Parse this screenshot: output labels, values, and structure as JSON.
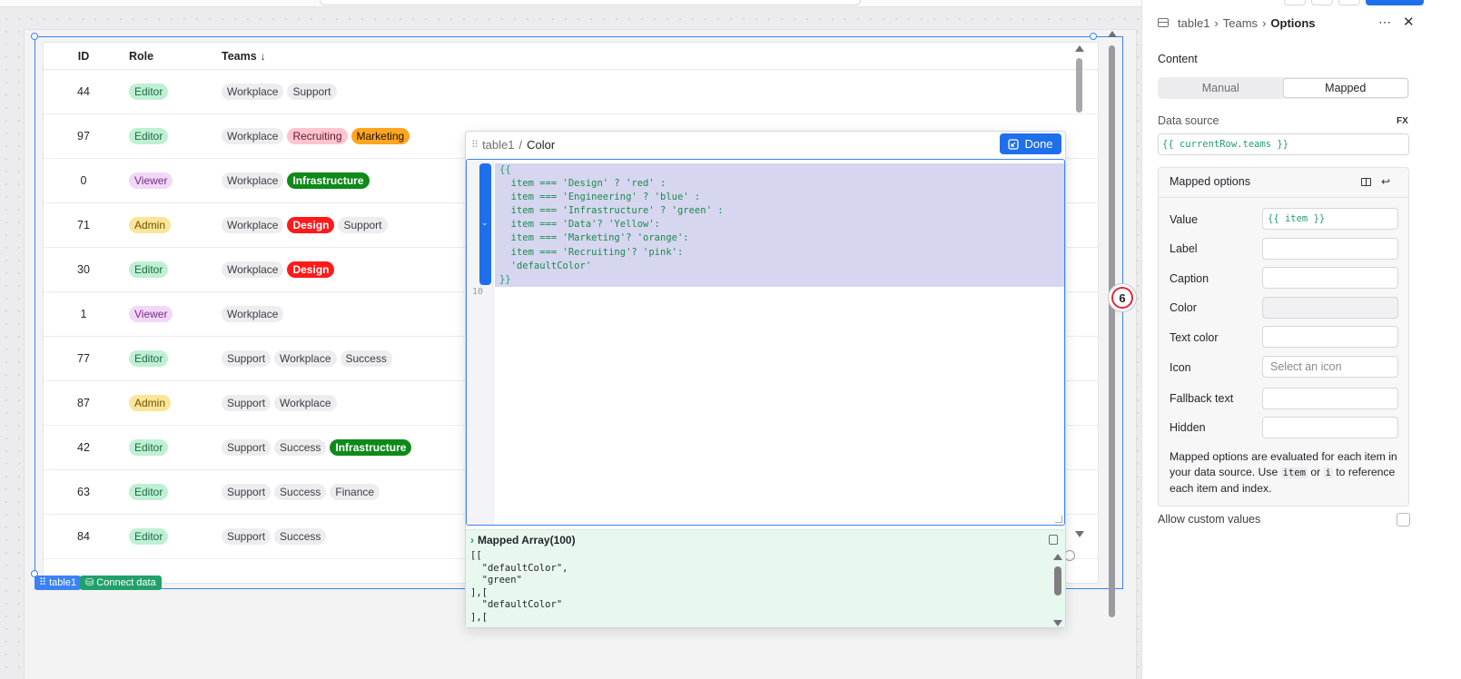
{
  "table": {
    "component_tag": "table1",
    "connect_label": "Connect data",
    "headers": {
      "id": "ID",
      "role": "Role",
      "teams": "Teams",
      "sort_icon": "↓"
    },
    "rows": [
      {
        "id": "44",
        "role": "Editor",
        "teams": [
          {
            "label": "Workplace",
            "color": "default"
          },
          {
            "label": "Support",
            "color": "default"
          }
        ]
      },
      {
        "id": "97",
        "role": "Editor",
        "teams": [
          {
            "label": "Workplace",
            "color": "default"
          },
          {
            "label": "Recruiting",
            "color": "pink"
          },
          {
            "label": "Marketing",
            "color": "orange"
          }
        ]
      },
      {
        "id": "0",
        "role": "Viewer",
        "teams": [
          {
            "label": "Workplace",
            "color": "default"
          },
          {
            "label": "Infrastructure",
            "color": "green"
          }
        ]
      },
      {
        "id": "71",
        "role": "Admin",
        "teams": [
          {
            "label": "Workplace",
            "color": "default"
          },
          {
            "label": "Design",
            "color": "red"
          },
          {
            "label": "Support",
            "color": "default"
          }
        ]
      },
      {
        "id": "30",
        "role": "Editor",
        "teams": [
          {
            "label": "Workplace",
            "color": "default"
          },
          {
            "label": "Design",
            "color": "red"
          }
        ]
      },
      {
        "id": "1",
        "role": "Viewer",
        "teams": [
          {
            "label": "Workplace",
            "color": "default"
          }
        ]
      },
      {
        "id": "77",
        "role": "Editor",
        "teams": [
          {
            "label": "Support",
            "color": "default"
          },
          {
            "label": "Workplace",
            "color": "default"
          },
          {
            "label": "Success",
            "color": "default"
          }
        ]
      },
      {
        "id": "87",
        "role": "Admin",
        "teams": [
          {
            "label": "Support",
            "color": "default"
          },
          {
            "label": "Workplace",
            "color": "default"
          }
        ]
      },
      {
        "id": "42",
        "role": "Editor",
        "teams": [
          {
            "label": "Support",
            "color": "default"
          },
          {
            "label": "Success",
            "color": "default"
          },
          {
            "label": "Infrastructure",
            "color": "green"
          }
        ]
      },
      {
        "id": "63",
        "role": "Editor",
        "teams": [
          {
            "label": "Support",
            "color": "default"
          },
          {
            "label": "Success",
            "color": "default"
          },
          {
            "label": "Finance",
            "color": "default"
          }
        ]
      },
      {
        "id": "84",
        "role": "Editor",
        "teams": [
          {
            "label": "Support",
            "color": "default"
          },
          {
            "label": "Success",
            "color": "default"
          }
        ]
      }
    ]
  },
  "canvas": {
    "badge_count": "6"
  },
  "code_popup": {
    "breadcrumb_parent": "table1",
    "breadcrumb_separator": "/",
    "breadcrumb_current": "Color",
    "done_label": "Done",
    "line_10": "10",
    "code_lines": [
      "{{",
      "  item === 'Design' ? 'red' :",
      "  item === 'Engineering' ? 'blue' :",
      "  item === 'Infrastructure' ? 'green' :",
      "  item === 'Data'? 'Yellow':",
      "  item === 'Marketing'? 'orange':",
      "  item === 'Recruiting'? 'pink':",
      "  'defaultColor'",
      "}}"
    ],
    "result_title": "Mapped Array(100)",
    "result_lines": [
      "[[",
      "  \"defaultColor\",",
      "  \"green\"",
      "],[",
      "  \"defaultColor\"",
      "],["
    ]
  },
  "inspector": {
    "breadcrumb": [
      "table1",
      "Teams",
      "Options"
    ],
    "more_icon": "⋯",
    "close_icon": "✕",
    "content_label": "Content",
    "segments": {
      "manual": "Manual",
      "mapped": "Mapped"
    },
    "data_source_label": "Data source",
    "fx_label": "FX",
    "data_source_value": "{{ currentRow.teams }}",
    "mapped_options_title": "Mapped options",
    "fields": {
      "value_label": "Value",
      "value_value": "{{ item }}",
      "label_label": "Label",
      "caption_label": "Caption",
      "color_label": "Color",
      "text_color_label": "Text color",
      "icon_label": "Icon",
      "icon_placeholder": "Select an icon",
      "fallback_label": "Fallback text",
      "hidden_label": "Hidden"
    },
    "note": {
      "part1": "Mapped options are evaluated for each item in your data source. Use",
      "code1": "item",
      "part2": "or",
      "code2": "i",
      "part3": "to reference each item and index."
    },
    "allow_custom_label": "Allow custom values"
  }
}
